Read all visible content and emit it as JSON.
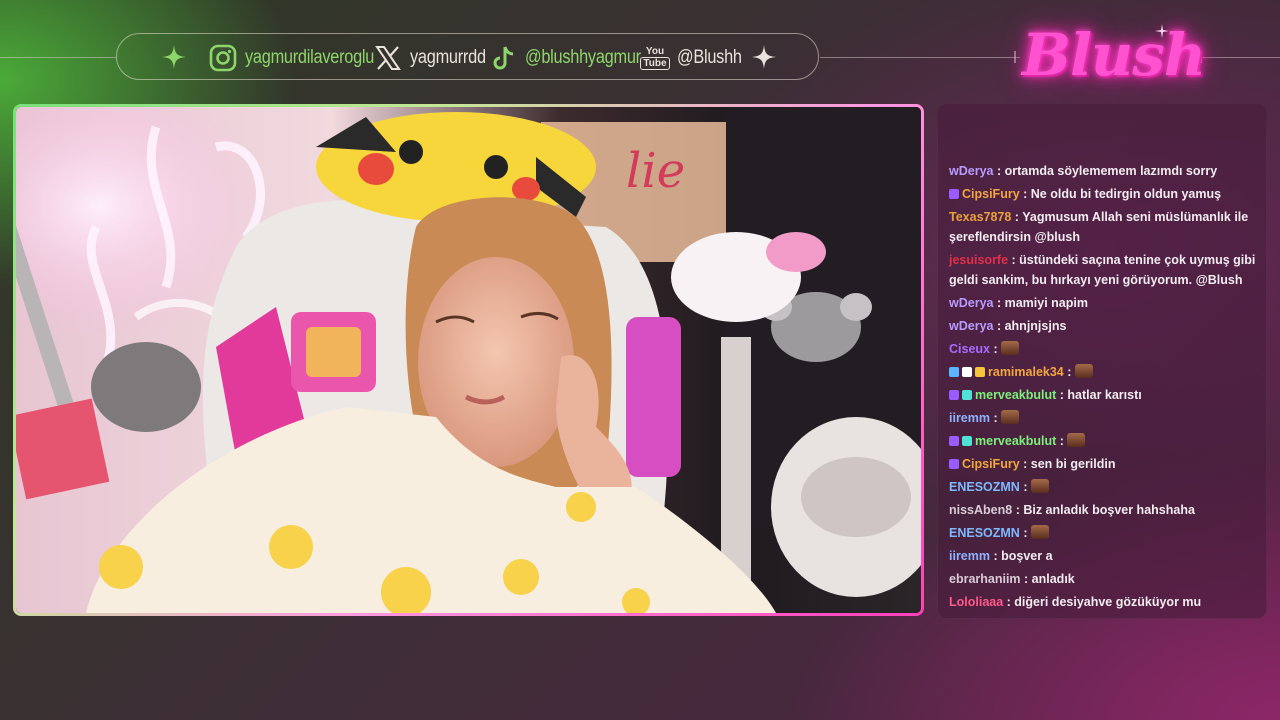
{
  "social": {
    "instagram": "yagmurdilaveroglu",
    "x": "yagmurrdd",
    "tiktok": "@blushhyagmur",
    "youtube": "@Blushh",
    "youtube_badge_top": "You",
    "youtube_badge_bottom": "Tube"
  },
  "logo": {
    "text": "Blush"
  },
  "chat": {
    "messages": [
      {
        "user": "wDerya",
        "text": "ortamda söylememem lazımdı sorry",
        "color": "#b89bff",
        "badges": []
      },
      {
        "user": "CipsiFury",
        "text": "Ne oldu bi tedirgin oldun yamuş",
        "color": "#f2a640",
        "badges": [
          "#9a5cff"
        ]
      },
      {
        "user": "Texas7878",
        "text": "Yagmusum Allah seni müslümanlık ile şereflendirsin @blush",
        "color": "#e8a23a",
        "badges": []
      },
      {
        "user": "jesuisorfe",
        "text": "üstündeki saçına tenine çok uymuş gibi geldi sankim, bu hırkayı yeni görüyorum. @Blush",
        "color": "#e0304a",
        "badges": []
      },
      {
        "user": "wDerya",
        "text": "mamiyi napim",
        "color": "#b89bff",
        "badges": []
      },
      {
        "user": "wDerya",
        "text": "ahnjnjsjns",
        "color": "#b89bff",
        "badges": []
      },
      {
        "user": "Ciseux",
        "text": "",
        "color": "#a86cff",
        "badges": [],
        "emote": true
      },
      {
        "user": "ramimalek34",
        "text": "",
        "color": "#f2a640",
        "badges": [
          "#5ab4ff",
          "#ffffff",
          "#f2c53a"
        ],
        "emote": true
      },
      {
        "user": "merveakbulut",
        "text": "hatlar karıstı",
        "color": "#7cf07a",
        "badges": [
          "#9a5cff",
          "#4fe0d8"
        ]
      },
      {
        "user": "iiremm",
        "text": "",
        "color": "#8fb2ff",
        "badges": [],
        "emote": true
      },
      {
        "user": "merveakbulut",
        "text": "",
        "color": "#7cf07a",
        "badges": [
          "#9a5cff",
          "#4fe0d8"
        ],
        "emote": true
      },
      {
        "user": "CipsiFury",
        "text": "sen bi gerildin",
        "color": "#f2a640",
        "badges": [
          "#9a5cff"
        ]
      },
      {
        "user": "ENESOZMN",
        "text": "",
        "color": "#7fb8ff",
        "badges": [],
        "emote": true
      },
      {
        "user": "nissAben8",
        "text": "Biz anladık boşver hahshaha",
        "color": "#d9cbd6",
        "badges": []
      },
      {
        "user": "ENESOZMN",
        "text": "",
        "color": "#7fb8ff",
        "badges": [],
        "emote": true
      },
      {
        "user": "iiremm",
        "text": "boşver a",
        "color": "#8fb2ff",
        "badges": []
      },
      {
        "user": "ebrarhaniim",
        "text": "anladık",
        "color": "#d9cbd6",
        "badges": []
      },
      {
        "user": "Lololiaaa",
        "text": "diğeri desiyahve gözüküyor mu",
        "color": "#ff5a8a",
        "badges": []
      }
    ]
  },
  "colors": {
    "accent_pink": "#ff3fb9",
    "accent_green": "#8ed66b"
  }
}
